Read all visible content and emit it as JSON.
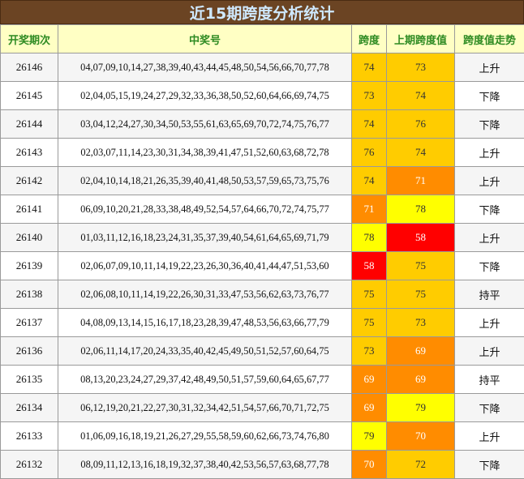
{
  "title": "近15期跨度分析统计",
  "headers": [
    "开奖期次",
    "中奖号",
    "跨度",
    "上期跨度值",
    "跨度值走势"
  ],
  "rows": [
    {
      "issue": "26146",
      "numbers": "04,07,09,10,14,27,38,39,40,43,44,45,48,50,54,56,66,70,77,78",
      "span": "74",
      "prev_span": "73",
      "trend": "上升",
      "span_color": "#ffcc00",
      "prev_color": "#ffcc00"
    },
    {
      "issue": "26145",
      "numbers": "02,04,05,15,19,24,27,29,32,33,36,38,50,52,60,64,66,69,74,75",
      "span": "73",
      "prev_span": "74",
      "trend": "下降",
      "span_color": "#ffcc00",
      "prev_color": "#ffcc00"
    },
    {
      "issue": "26144",
      "numbers": "03,04,12,24,27,30,34,50,53,55,61,63,65,69,70,72,74,75,76,77",
      "span": "74",
      "prev_span": "76",
      "trend": "下降",
      "span_color": "#ffcc00",
      "prev_color": "#ffcc00"
    },
    {
      "issue": "26143",
      "numbers": "02,03,07,11,14,23,30,31,34,38,39,41,47,51,52,60,63,68,72,78",
      "span": "76",
      "prev_span": "74",
      "trend": "上升",
      "span_color": "#ffcc00",
      "prev_color": "#ffcc00"
    },
    {
      "issue": "26142",
      "numbers": "02,04,10,14,18,21,26,35,39,40,41,48,50,53,57,59,65,73,75,76",
      "span": "74",
      "prev_span": "71",
      "trend": "上升",
      "span_color": "#ffcc00",
      "prev_color": "#ff8c00"
    },
    {
      "issue": "26141",
      "numbers": "06,09,10,20,21,28,33,38,48,49,52,54,57,64,66,70,72,74,75,77",
      "span": "71",
      "prev_span": "78",
      "trend": "下降",
      "span_color": "#ff8c00",
      "prev_color": "#ffff00"
    },
    {
      "issue": "26140",
      "numbers": "01,03,11,12,16,18,23,24,31,35,37,39,40,54,61,64,65,69,71,79",
      "span": "78",
      "prev_span": "58",
      "trend": "上升",
      "span_color": "#ffff00",
      "prev_color": "#ff0000"
    },
    {
      "issue": "26139",
      "numbers": "02,06,07,09,10,11,14,19,22,23,26,30,36,40,41,44,47,51,53,60",
      "span": "58",
      "prev_span": "75",
      "trend": "下降",
      "span_color": "#ff0000",
      "prev_color": "#ffcc00"
    },
    {
      "issue": "26138",
      "numbers": "02,06,08,10,11,14,19,22,26,30,31,33,47,53,56,62,63,73,76,77",
      "span": "75",
      "prev_span": "75",
      "trend": "持平",
      "span_color": "#ffcc00",
      "prev_color": "#ffcc00"
    },
    {
      "issue": "26137",
      "numbers": "04,08,09,13,14,15,16,17,18,23,28,39,47,48,53,56,63,66,77,79",
      "span": "75",
      "prev_span": "73",
      "trend": "上升",
      "span_color": "#ffcc00",
      "prev_color": "#ffcc00"
    },
    {
      "issue": "26136",
      "numbers": "02,06,11,14,17,20,24,33,35,40,42,45,49,50,51,52,57,60,64,75",
      "span": "73",
      "prev_span": "69",
      "trend": "上升",
      "span_color": "#ffcc00",
      "prev_color": "#ff8c00"
    },
    {
      "issue": "26135",
      "numbers": "08,13,20,23,24,27,29,37,42,48,49,50,51,57,59,60,64,65,67,77",
      "span": "69",
      "prev_span": "69",
      "trend": "持平",
      "span_color": "#ff8c00",
      "prev_color": "#ff8c00"
    },
    {
      "issue": "26134",
      "numbers": "06,12,19,20,21,22,27,30,31,32,34,42,51,54,57,66,70,71,72,75",
      "span": "69",
      "prev_span": "79",
      "trend": "下降",
      "span_color": "#ff8c00",
      "prev_color": "#ffff00"
    },
    {
      "issue": "26133",
      "numbers": "01,06,09,16,18,19,21,26,27,29,55,58,59,60,62,66,73,74,76,80",
      "span": "79",
      "prev_span": "70",
      "trend": "上升",
      "span_color": "#ffff00",
      "prev_color": "#ff8c00"
    },
    {
      "issue": "26132",
      "numbers": "08,09,11,12,13,16,18,19,32,37,38,40,42,53,56,57,63,68,77,78",
      "span": "70",
      "prev_span": "72",
      "trend": "下降",
      "span_color": "#ff8c00",
      "prev_color": "#ffcc00"
    }
  ]
}
